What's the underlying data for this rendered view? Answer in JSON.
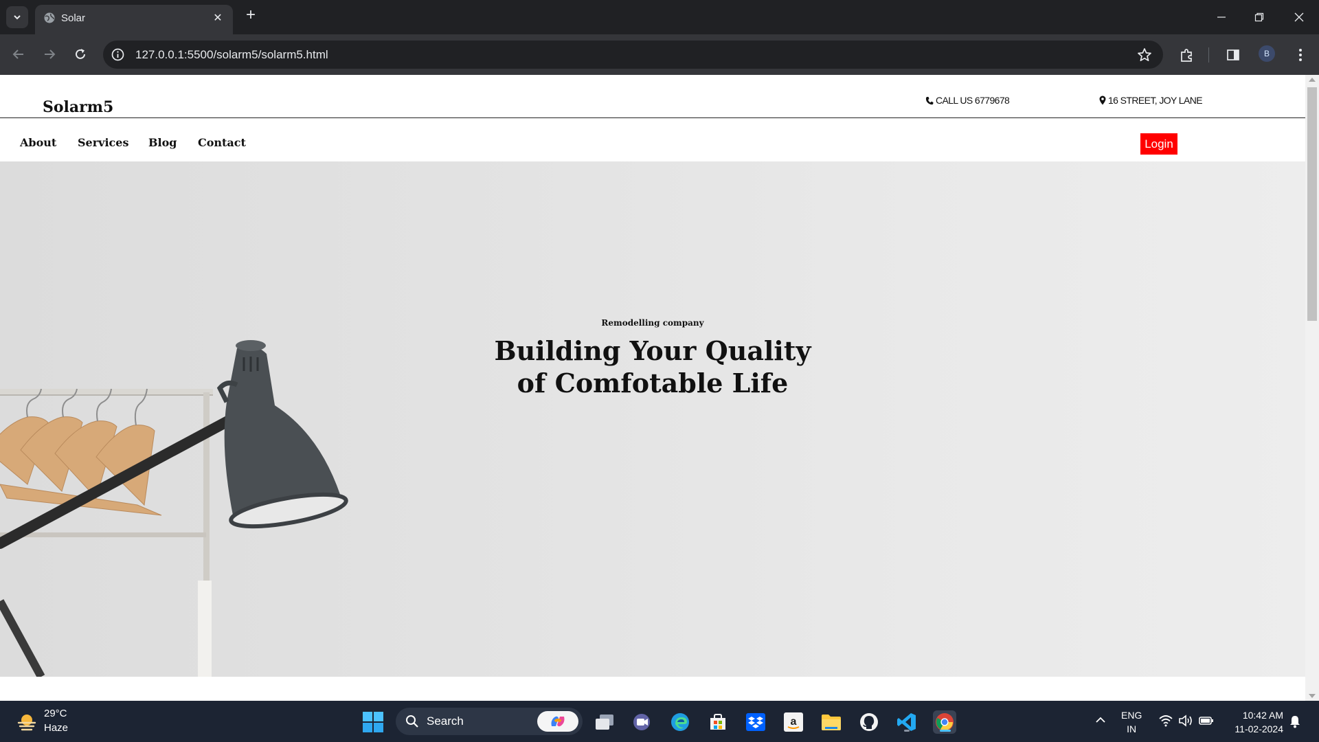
{
  "browser": {
    "tab_title": "Solar",
    "url": "127.0.0.1:5500/solarm5/solarm5.html",
    "profile_initial": "B"
  },
  "site": {
    "logo": "Solarm5",
    "phone": "CALL US 6779678",
    "address": "16 STREET, JOY LANE",
    "nav": [
      {
        "label": "About"
      },
      {
        "label": "Services"
      },
      {
        "label": "Blog"
      },
      {
        "label": "Contact"
      }
    ],
    "login_label": "Login",
    "accent_color": "#ff0000"
  },
  "hero": {
    "kicker": "Remodelling company",
    "title_line1": "Building Your Quality",
    "title_line2": "of Comfotable Life"
  },
  "taskbar": {
    "weather_temp": "29°C",
    "weather_condition": "Haze",
    "search_label": "Search",
    "language": "ENG",
    "region": "IN",
    "time": "10:42 AM",
    "date": "11-02-2024"
  }
}
